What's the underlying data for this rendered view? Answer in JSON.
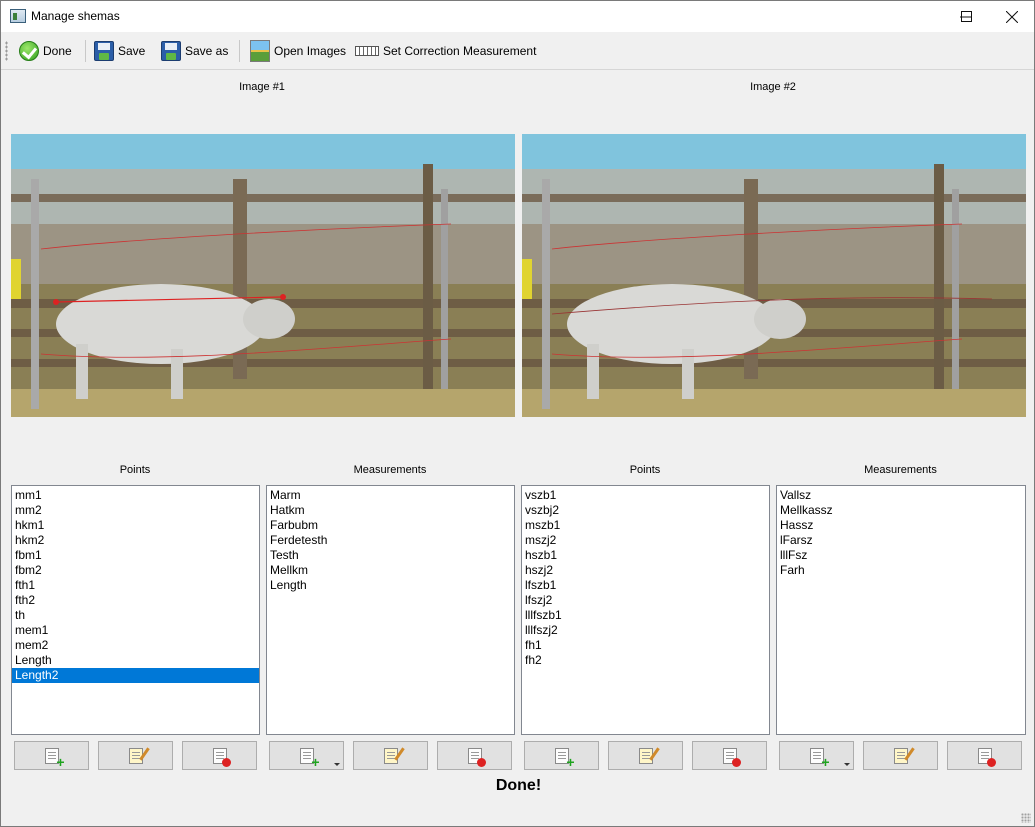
{
  "window": {
    "title": "Manage shemas",
    "minimize": "—",
    "maximize": "☐",
    "close": "✕"
  },
  "toolbar": {
    "done_label": "Done",
    "save_label": "Save",
    "save_as_label": "Save as",
    "open_images_label": "Open Images",
    "set_correction_label": "Set Correction Measurement"
  },
  "images": {
    "left_label": "Image #1",
    "right_label": "Image #2"
  },
  "left": {
    "points_label": "Points",
    "measurements_label": "Measurements",
    "points": [
      "mm1",
      "mm2",
      "hkm1",
      "hkm2",
      "fbm1",
      "fbm2",
      "fth1",
      "fth2",
      "th",
      "mem1",
      "mem2",
      "Length",
      "Length2"
    ],
    "selected_point": "Length2",
    "measurements": [
      "Marm",
      "Hatkm",
      "Farbubm",
      "Ferdetesth",
      "Testh",
      "Mellkm",
      "Length"
    ]
  },
  "right": {
    "points_label": "Points",
    "measurements_label": "Measurements",
    "points": [
      "vszb1",
      "vszbj2",
      "mszb1",
      "mszj2",
      "hszb1",
      "hszj2",
      "lfszb1",
      "lfszj2",
      "lllfszb1",
      "lllfszj2",
      "fh1",
      "fh2"
    ],
    "measurements": [
      "Vallsz",
      "Mellkassz",
      "Hassz",
      "lFarsz",
      "lllFsz",
      "Farh"
    ]
  },
  "status": "Done!",
  "colors": {
    "selection": "#0078d7",
    "sky": "#7fc4de",
    "ground": "#8a7f55"
  }
}
